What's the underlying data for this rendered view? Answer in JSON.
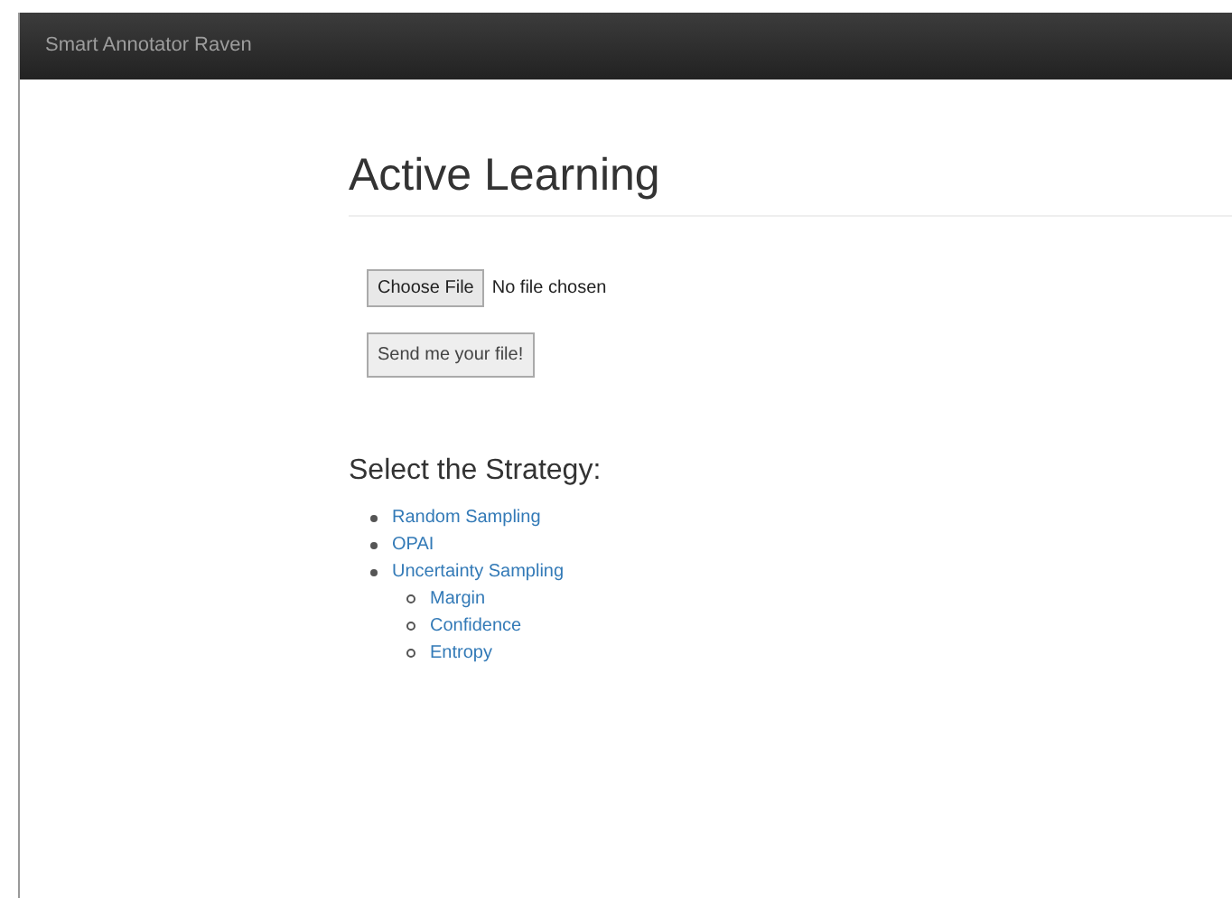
{
  "navbar": {
    "brand": "Smart Annotator Raven"
  },
  "heading": "Active Learning",
  "file_input": {
    "button": "Choose File",
    "status": "No file chosen"
  },
  "submit_button": "Send me your file!",
  "strategy": {
    "title": "Select the Strategy:",
    "items": [
      {
        "label": "Random Sampling"
      },
      {
        "label": "OPAI"
      },
      {
        "label": "Uncertainty Sampling",
        "children": [
          {
            "label": "Margin"
          },
          {
            "label": "Confidence"
          },
          {
            "label": "Entropy"
          }
        ]
      }
    ]
  }
}
